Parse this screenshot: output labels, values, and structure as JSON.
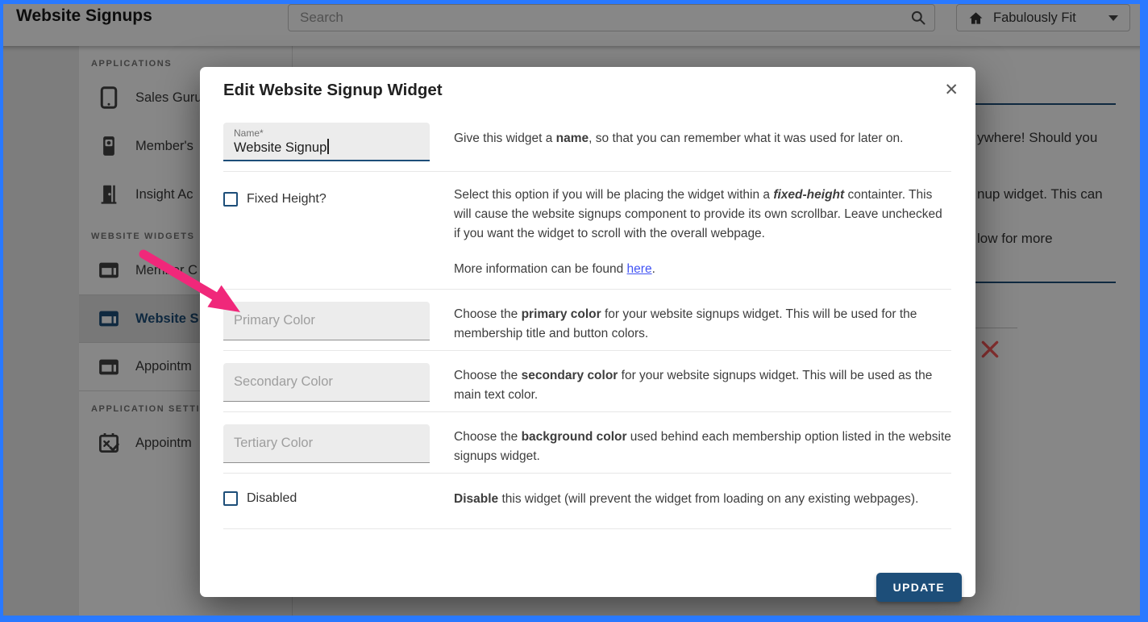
{
  "colors": {
    "brand_navy": "#1d4e79",
    "frame_blue": "#2979ff",
    "arrow_pink": "#f0287a",
    "link_blue": "#4254f4",
    "delete_red": "#ff5c5c"
  },
  "header": {
    "title": "Website Signups",
    "search_placeholder": "Search",
    "account_label": "Fabulously Fit"
  },
  "sidebar": {
    "sections": [
      {
        "label": "APPLICATIONS",
        "items": [
          {
            "label": "Sales Guru",
            "icon": "tablet-icon"
          },
          {
            "label": "Member's",
            "icon": "member-phone-icon"
          },
          {
            "label": "Insight Ac",
            "icon": "door-icon"
          }
        ]
      },
      {
        "label": "WEBSITE WIDGETS",
        "items": [
          {
            "label": "Member C",
            "icon": "widget-icon",
            "ruled": false
          },
          {
            "label": "Website S",
            "icon": "widget-icon",
            "selected": true
          },
          {
            "label": "Appointm",
            "icon": "widget-icon",
            "ruled": true
          }
        ]
      },
      {
        "label": "APPLICATION SETTIN",
        "items": [
          {
            "label": "Appointm",
            "icon": "calendar-settings-icon"
          }
        ]
      }
    ]
  },
  "background_page": {
    "fragments": [
      {
        "text": "ywhere! Should you"
      },
      {
        "text": "nup widget. This can"
      },
      {
        "text": "low for more"
      }
    ]
  },
  "modal": {
    "title": "Edit Website Signup Widget",
    "close_glyph": "✕",
    "name_field": {
      "label": "Name*",
      "value": "Website Signup"
    },
    "name_desc": [
      {
        "t": "Give this widget a "
      },
      {
        "t": "name",
        "b": true
      },
      {
        "t": ", so that you can remember what it was used for later on."
      }
    ],
    "fixed_height": {
      "label": "Fixed Height?",
      "desc": [
        {
          "t": "Select this option if you will be placing the widget within a "
        },
        {
          "t": "fixed-height",
          "b": true,
          "i": true
        },
        {
          "t": " containter. This will cause the website signups component to provide its own scrollbar. Leave unchecked if you want the widget to scroll with the overall webpage."
        }
      ],
      "more": [
        {
          "t": "More information can be found "
        },
        {
          "t": "here",
          "link": true
        },
        {
          "t": "."
        }
      ]
    },
    "primary": {
      "placeholder": "Primary Color",
      "desc": [
        {
          "t": "Choose the "
        },
        {
          "t": "primary color",
          "b": true
        },
        {
          "t": " for your website signups widget. This will be used for the membership title and button colors."
        }
      ]
    },
    "secondary": {
      "placeholder": "Secondary Color",
      "desc": [
        {
          "t": "Choose the "
        },
        {
          "t": "secondary color",
          "b": true
        },
        {
          "t": " for your website signups widget. This will be used as the main text color."
        }
      ]
    },
    "tertiary": {
      "placeholder": "Tertiary Color",
      "desc": [
        {
          "t": "Choose the "
        },
        {
          "t": "background color",
          "b": true
        },
        {
          "t": " used behind each membership option listed in the website signups widget."
        }
      ]
    },
    "disabled": {
      "label": "Disabled",
      "desc": [
        {
          "t": "Disable",
          "b": true
        },
        {
          "t": " this widget (will prevent the widget from loading on any existing webpages)."
        }
      ]
    },
    "update_label": "UPDATE"
  }
}
